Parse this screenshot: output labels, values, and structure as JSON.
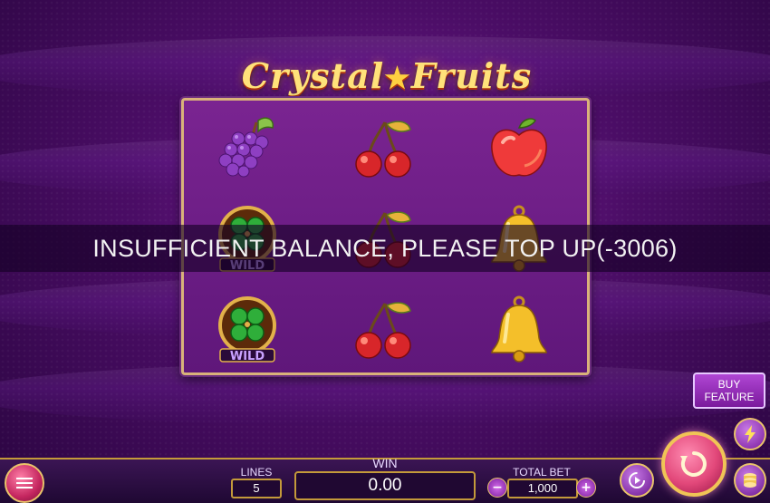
{
  "game": {
    "title_part1": "Crystal",
    "title_part2": "Fruits",
    "title_star": "★"
  },
  "reels": [
    [
      "grapes",
      "cherries",
      "apple"
    ],
    [
      "wild",
      "cherries",
      "bell"
    ],
    [
      "wild",
      "cherries",
      "bell"
    ]
  ],
  "wild_label": "WILD",
  "message": "INSUFFICIENT BALANCE, PLEASE TOP UP(-3006)",
  "buy_feature": {
    "line1": "BUY",
    "line2": "FEATURE"
  },
  "controls": {
    "lines_label": "LINES",
    "lines_value": "5",
    "win_label": "WIN",
    "win_value": "0.00",
    "total_bet_label": "TOTAL BET",
    "total_bet_value": "1,000",
    "minus": "−",
    "plus": "+"
  },
  "icons": {
    "menu": "hamburger-icon",
    "autoplay": "autoplay-icon",
    "spin": "spin-arrow-icon",
    "turbo": "lightning-icon",
    "balance": "coins-stack-icon"
  },
  "colors": {
    "background": "#4b0d66",
    "gold": "#c49a3a",
    "spin_button": "#e2487a",
    "buy_feature": "#a23fc8"
  }
}
